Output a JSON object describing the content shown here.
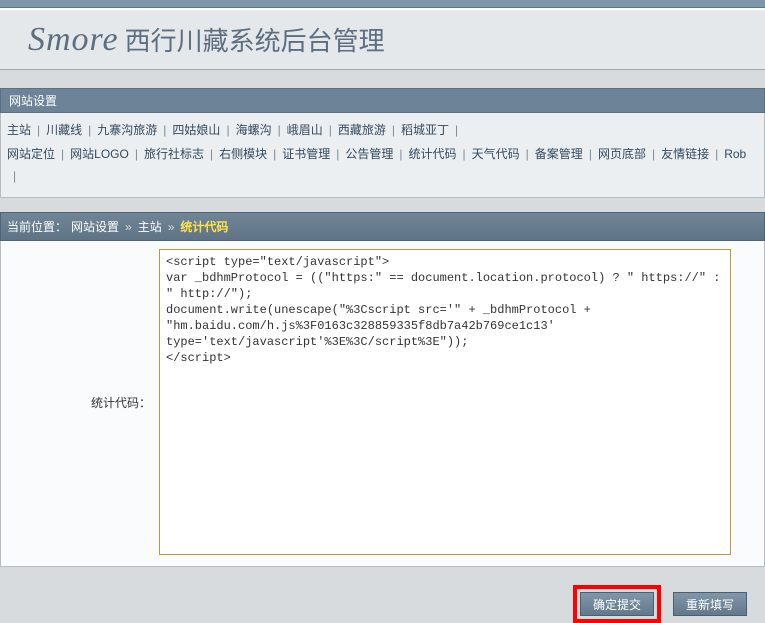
{
  "header": {
    "logo": "Smore",
    "title": "西行川藏系统后台管理"
  },
  "panel": {
    "title": "网站设置"
  },
  "nav_row1": [
    "主站",
    "川藏线",
    "九寨沟旅游",
    "四姑娘山",
    "海螺沟",
    "峨眉山",
    "西藏旅游",
    "稻城亚丁"
  ],
  "nav_row2": [
    "网站定位",
    "网站LOGO",
    "旅行社标志",
    "右侧模块",
    "证书管理",
    "公告管理",
    "统计代码",
    "天气代码",
    "备案管理",
    "网页底部",
    "友情链接",
    "Rob"
  ],
  "breadcrumb": {
    "label": "当前位置：",
    "parts": [
      "网站设置",
      "主站"
    ],
    "current": "统计代码"
  },
  "form": {
    "label": "统计代码：",
    "textarea_value": "<script type=\"text/javascript\">\nvar _bdhmProtocol = ((\"https:\" == document.location.protocol) ? \" https://\" : \" http://\");\ndocument.write(unescape(\"%3Cscript src='\" + _bdhmProtocol + \"hm.baidu.com/h.js%3F0163c328859335f8db7a42b769ce1c13' type='text/javascript'%3E%3C/script%3E\"));\n</script>\n"
  },
  "buttons": {
    "submit": "确定提交",
    "reset": "重新填写"
  }
}
